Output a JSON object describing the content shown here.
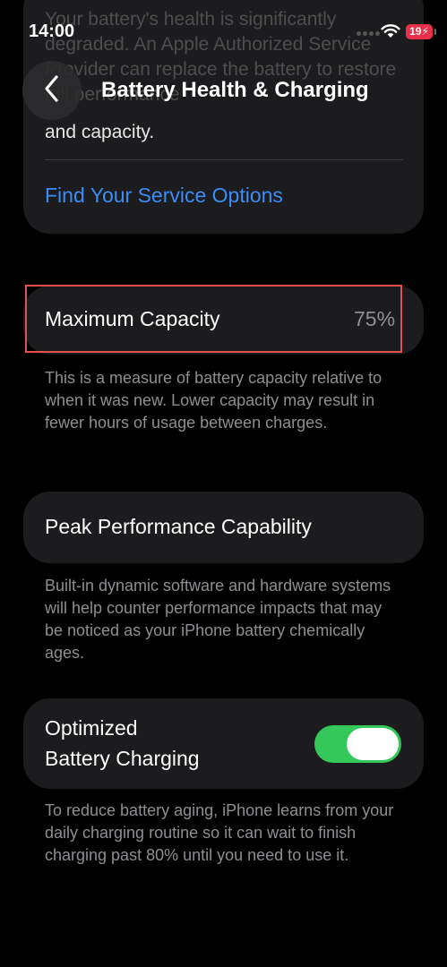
{
  "status_bar": {
    "time": "14:00",
    "battery_level": "19",
    "icons": [
      "signal-dots-icon",
      "wifi-icon",
      "battery-icon"
    ],
    "battery_color": "#e8304a"
  },
  "header": {
    "title": "Battery Health & Charging",
    "back_icon": "chevron-left-icon"
  },
  "service_card": {
    "faded_text": "Your battery's health is significantly degraded. An Apple Authorized Service Provider can replace the battery to restore full performance",
    "visible_text": "and capacity.",
    "link_label": "Find Your Service Options",
    "link_color": "#3a8cf6"
  },
  "maximum_capacity": {
    "label": "Maximum Capacity",
    "value": "75%",
    "description": "This is a measure of battery capacity relative to when it was new. Lower capacity may result in fewer hours of usage between charges."
  },
  "peak_performance": {
    "label": "Peak Performance Capability",
    "description": "Built-in dynamic software and hardware systems will help counter performance impacts that may be noticed as your iPhone battery chemically ages."
  },
  "optimized_charging": {
    "label_line1": "Optimized",
    "label_line2": "Battery Charging",
    "toggle_on": true,
    "toggle_color": "#34c759",
    "description": "To reduce battery aging, iPhone learns from your daily charging routine so it can wait to finish charging past 80% until you need to use it."
  }
}
